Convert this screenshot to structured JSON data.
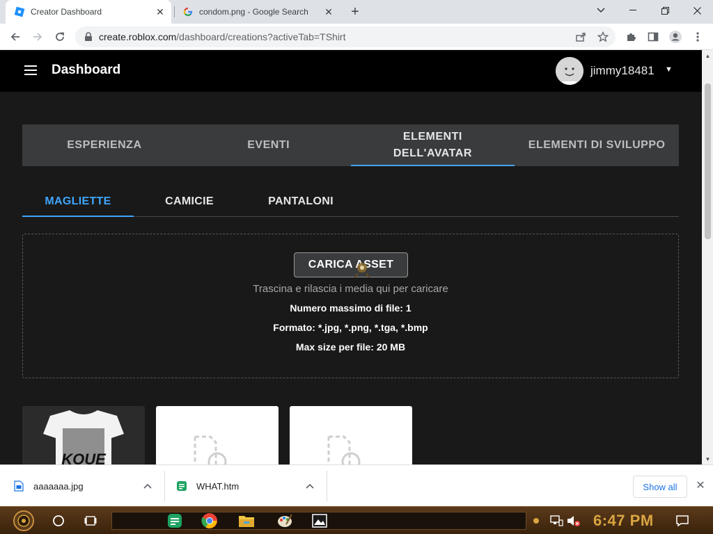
{
  "browser": {
    "tabs": [
      {
        "title": "Creator Dashboard",
        "active": true
      },
      {
        "title": "condom.png - Google Search",
        "active": false
      }
    ],
    "url_host": "create.roblox.com",
    "url_path": "/dashboard/creations?activeTab=TShirt"
  },
  "header": {
    "title": "Dashboard",
    "username": "jimmy18481"
  },
  "main_tabs": [
    {
      "label": "ESPERIENZA",
      "active": false
    },
    {
      "label": "EVENTI",
      "active": false
    },
    {
      "label": "ELEMENTI\nDELL'AVATAR",
      "active": true
    },
    {
      "label": "ELEMENTI DI SVILUPPO",
      "active": false
    }
  ],
  "sub_tabs": [
    {
      "label": "MAGLIETTE",
      "active": true
    },
    {
      "label": "CAMICIE",
      "active": false
    },
    {
      "label": "PANTALONI",
      "active": false
    }
  ],
  "upload": {
    "button_label": "CARICA ASSET",
    "hint": "Trascina e rilascia i media qui per caricare",
    "max_files": "Numero massimo di file: 1",
    "format": "Formato: *.jpg, *.png, *.tga, *.bmp",
    "max_size": "Max size per file: 20 MB"
  },
  "thumbnails": [
    {
      "type": "tshirt-image",
      "text": "KOUE"
    },
    {
      "type": "placeholder"
    },
    {
      "type": "placeholder"
    }
  ],
  "downloads": {
    "items": [
      {
        "name": "aaaaaaa.jpg",
        "icon": "image-file-icon"
      },
      {
        "name": "WHAT.htm",
        "icon": "html-file-icon"
      }
    ],
    "show_all": "Show all"
  },
  "taskbar": {
    "time": "6:47 PM"
  },
  "colors": {
    "accent": "#3ea6ff",
    "page_bg": "#191919",
    "header_bg": "#000000",
    "tab_bg": "#393b3d"
  }
}
